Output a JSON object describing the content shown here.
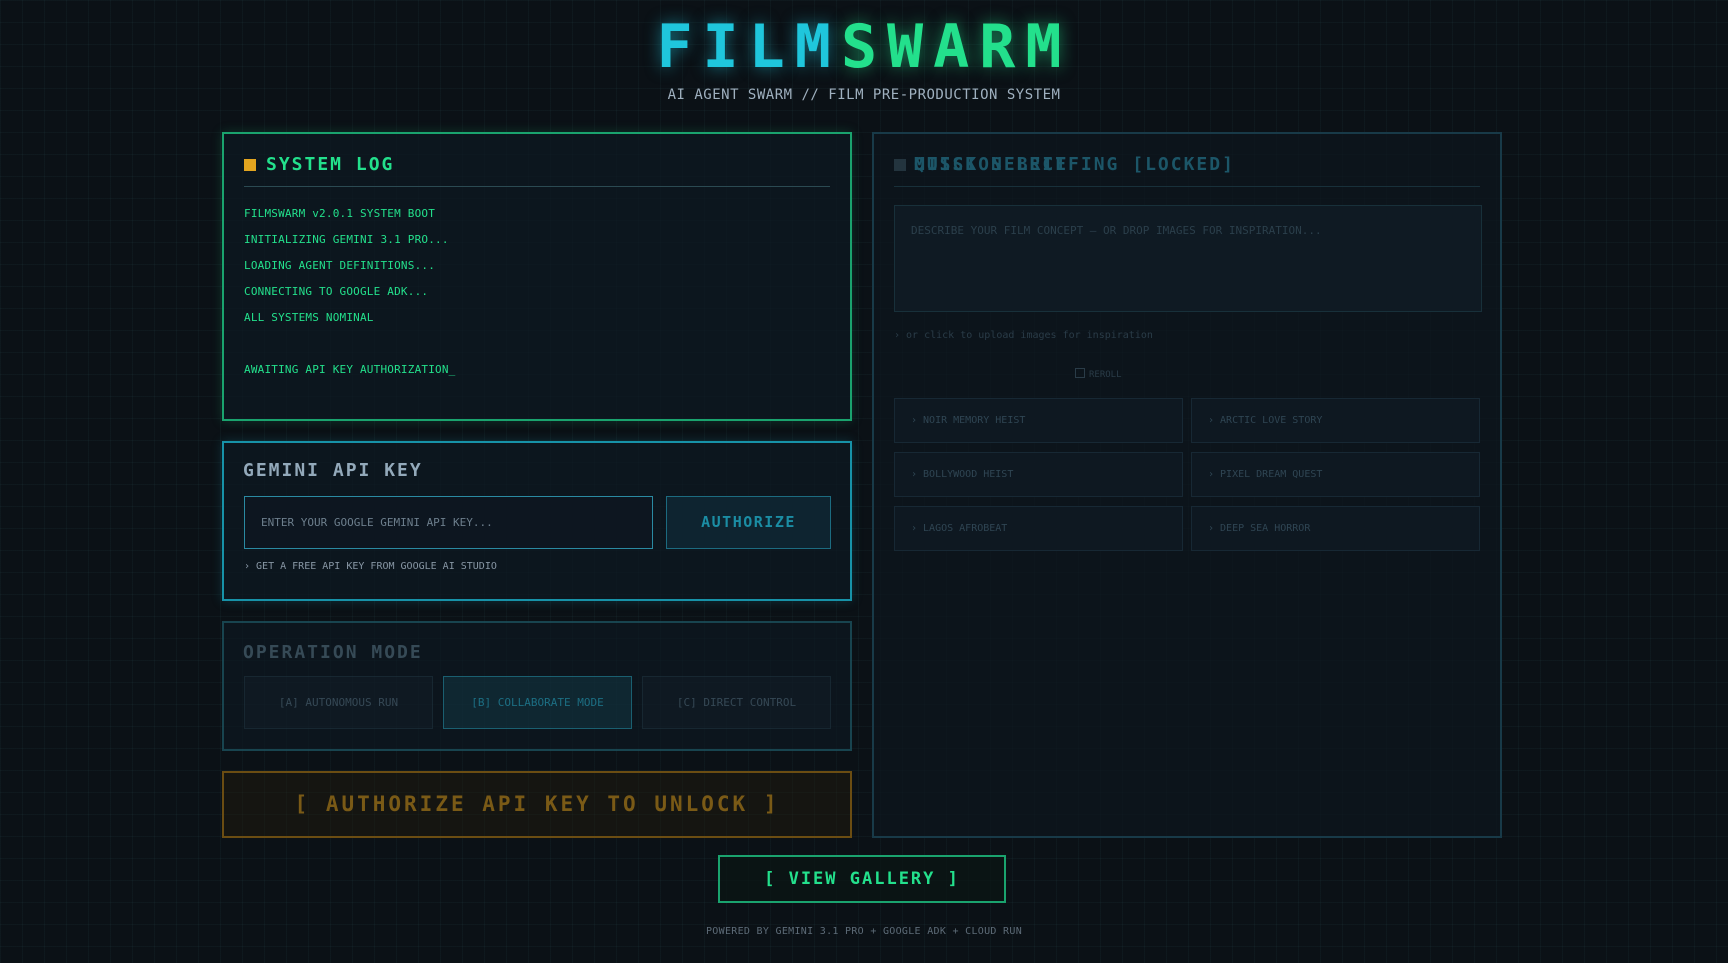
{
  "header": {
    "title_part1": "FILM",
    "title_part2": "SWARM",
    "subtitle": "AI AGENT SWARM // FILM PRE-PRODUCTION SYSTEM"
  },
  "system_log": {
    "title": "SYSTEM LOG",
    "lines": [
      "FILMSWARM v2.0.1 SYSTEM BOOT",
      "INITIALIZING GEMINI 3.1 PRO...",
      "LOADING AGENT DEFINITIONS...",
      "CONNECTING TO GOOGLE ADK...",
      "ALL SYSTEMS NOMINAL",
      "AWAITING API KEY AUTHORIZATION_"
    ]
  },
  "api_key": {
    "title": "GEMINI API KEY",
    "placeholder": "ENTER YOUR GOOGLE GEMINI API KEY...",
    "authorize_label": "AUTHORIZE",
    "hint": "› GET A FREE API KEY FROM GOOGLE AI STUDIO"
  },
  "operation_mode": {
    "title": "OPERATION MODE",
    "modes": [
      "[A] AUTONOMOUS RUN",
      "[B] COLLABORATE MODE",
      "[C] DIRECT CONTROL"
    ],
    "selected": "[B] COLLABORATE MODE"
  },
  "unlock_label": "[ AUTHORIZE API KEY TO UNLOCK ]",
  "mission": {
    "title": "MISSION BRIEFING [LOCKED]",
    "placeholder": "DESCRIBE YOUR FILM CONCEPT — OR DROP IMAGES FOR INSPIRATION...",
    "upload_hint": "› or click to upload images for inspiration",
    "quick_select_title": "QUICK SELECT",
    "reroll_label": "REROLL",
    "presets": [
      "› NOIR MEMORY HEIST",
      "› ARCTIC LOVE STORY",
      "› BOLLYWOOD HEIST",
      "› PIXEL DREAM QUEST",
      "› LAGOS AFROBEAT",
      "› DEEP SEA HORROR"
    ]
  },
  "gallery_label": "[ VIEW GALLERY ]",
  "footer": "POWERED BY GEMINI 3.1 PRO + GOOGLE ADK + CLOUD RUN",
  "colors": {
    "accent_green": "#23e08c",
    "accent_cyan": "#1fc6dc",
    "warning_amber": "#e3a51f",
    "background": "#0b1116"
  },
  "icons": {
    "log_status": "square-status-icon",
    "mission_status": "square-status-icon"
  }
}
